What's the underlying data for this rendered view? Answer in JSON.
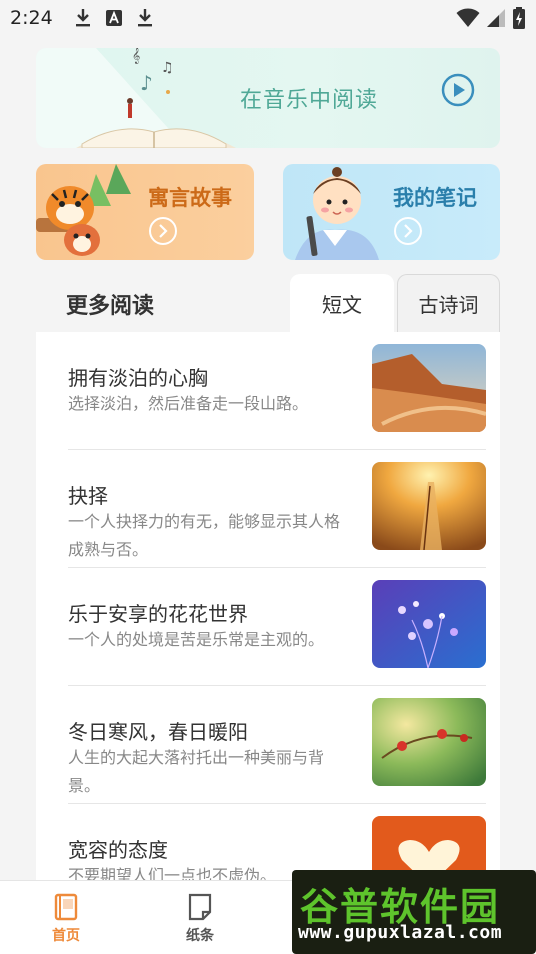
{
  "status_bar": {
    "time": "2:24",
    "icons": [
      "download-icon",
      "a-badge-icon",
      "download-icon",
      "wifi-icon",
      "signal-icon",
      "battery-charging-icon"
    ]
  },
  "banner": {
    "title": "在音乐中阅读",
    "play_icon": "play-circle-icon"
  },
  "cards": {
    "fable": {
      "title": "寓言故事",
      "arrow_icon": "chevron-right-circle-icon"
    },
    "notes": {
      "title": "我的笔记",
      "arrow_icon": "chevron-right-circle-icon"
    }
  },
  "more_reading": {
    "title": "更多阅读",
    "tabs": [
      {
        "label": "短文",
        "active": true
      },
      {
        "label": "古诗词",
        "active": false
      }
    ]
  },
  "articles": [
    {
      "title": "拥有淡泊的心胸",
      "desc": "选择淡泊，然后准备走一段山路。"
    },
    {
      "title": "抉择",
      "desc": "一个人抉择力的有无，能够显示其人格成熟与否。"
    },
    {
      "title": "乐于安享的花花世界",
      "desc": "一个人的处境是苦是乐常是主观的。"
    },
    {
      "title": "冬日寒风，春日暖阳",
      "desc": "人生的大起大落衬托出一种美丽与背景。"
    },
    {
      "title": "宽容的态度",
      "desc": "不要期望人们一点也不虚伪。"
    }
  ],
  "bottom_nav": [
    {
      "label": "首页",
      "icon": "book-icon",
      "active": true
    },
    {
      "label": "纸条",
      "icon": "note-icon",
      "active": false
    }
  ],
  "watermark": {
    "main": "谷普软件园",
    "url": "www.gupuxlazal.com"
  },
  "colors": {
    "accent": "#ee8a3a",
    "banner_text": "#4fa896",
    "fable_text": "#cc6a18",
    "notes_text": "#2a7fab"
  }
}
